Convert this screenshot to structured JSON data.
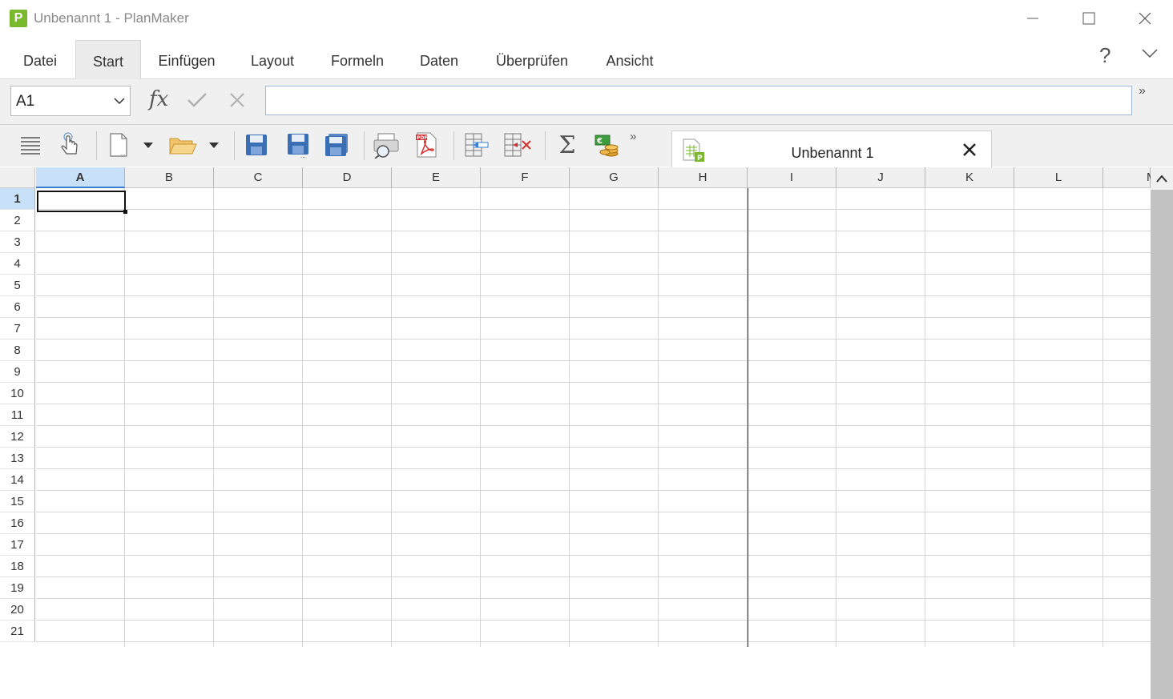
{
  "window": {
    "title": "Unbenannt 1 - PlanMaker",
    "logo_letter": "P"
  },
  "menu": {
    "items": [
      {
        "label": "Datei"
      },
      {
        "label": "Start",
        "active": true
      },
      {
        "label": "Einfügen"
      },
      {
        "label": "Layout"
      },
      {
        "label": "Formeln"
      },
      {
        "label": "Daten"
      },
      {
        "label": "Überprüfen"
      },
      {
        "label": "Ansicht"
      }
    ],
    "help": "?"
  },
  "formula_bar": {
    "cell_reference": "A1",
    "fx_label": "fx",
    "formula_value": "",
    "more": "»"
  },
  "toolbar": {
    "icons": [
      "menu-icon",
      "touch-mode-icon",
      "new-document-icon",
      "open-folder-icon",
      "save-icon",
      "save-as-icon",
      "save-all-icon",
      "print-preview-icon",
      "export-pdf-icon",
      "insert-cells-icon",
      "delete-cells-icon",
      "autosum-icon",
      "currency-icon"
    ],
    "autosum_glyph": "Σ",
    "more": "»"
  },
  "document_tab": {
    "label": "Unbenannt 1"
  },
  "sheet": {
    "columns": [
      "A",
      "B",
      "C",
      "D",
      "E",
      "F",
      "G",
      "H",
      "I",
      "J",
      "K",
      "L",
      "M"
    ],
    "rows": [
      "1",
      "2",
      "3",
      "4",
      "5",
      "6",
      "7",
      "8",
      "9",
      "10",
      "11",
      "12",
      "13",
      "14",
      "15",
      "16",
      "17",
      "18",
      "19",
      "20",
      "21"
    ],
    "selected_column": "A",
    "selected_row": "1"
  },
  "colors": {
    "selection": "#c8e0f8",
    "logo": "#7ab82e",
    "save_icon": "#3a6fb5"
  }
}
